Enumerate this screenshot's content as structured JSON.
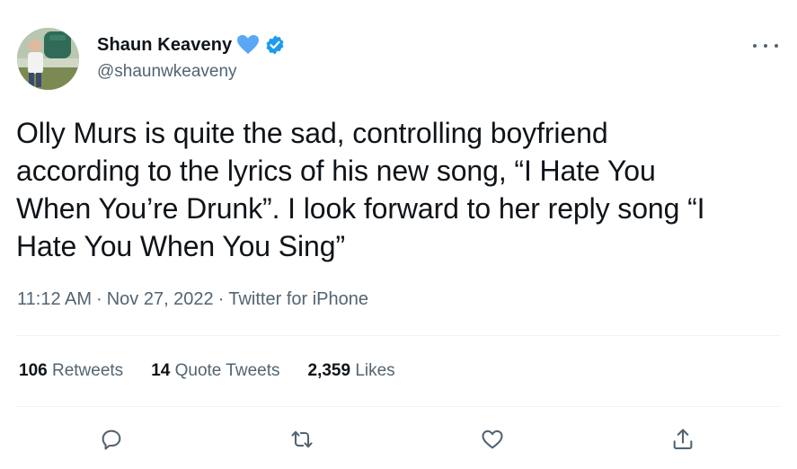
{
  "author": {
    "display_name": "Shaun Keaveny",
    "handle": "@shaunwkeaveny",
    "heart_color": "#5ba7f5",
    "verified_color": "#1d9bf0"
  },
  "tweet": {
    "text": "Olly Murs is quite the sad, controlling boyfriend\naccording to the lyrics of his new song, “I Hate You\nWhen You’re Drunk”. I look forward to her reply song “I\nHate You When You Sing”",
    "time": "11:12 AM",
    "date": "Nov 27, 2022",
    "separator": "·",
    "source": "Twitter for iPhone"
  },
  "stats": {
    "retweets_count": "106",
    "retweets_label": "Retweets",
    "quotes_count": "14",
    "quotes_label": "Quote Tweets",
    "likes_count": "2,359",
    "likes_label": "Likes"
  },
  "icons": {
    "reply": "reply-icon",
    "retweet": "retweet-icon",
    "like": "heart-icon",
    "share": "share-icon",
    "more": "more-icon"
  },
  "colors": {
    "text": "#0f1419",
    "secondary": "#536471",
    "divider": "#eff3f4"
  }
}
